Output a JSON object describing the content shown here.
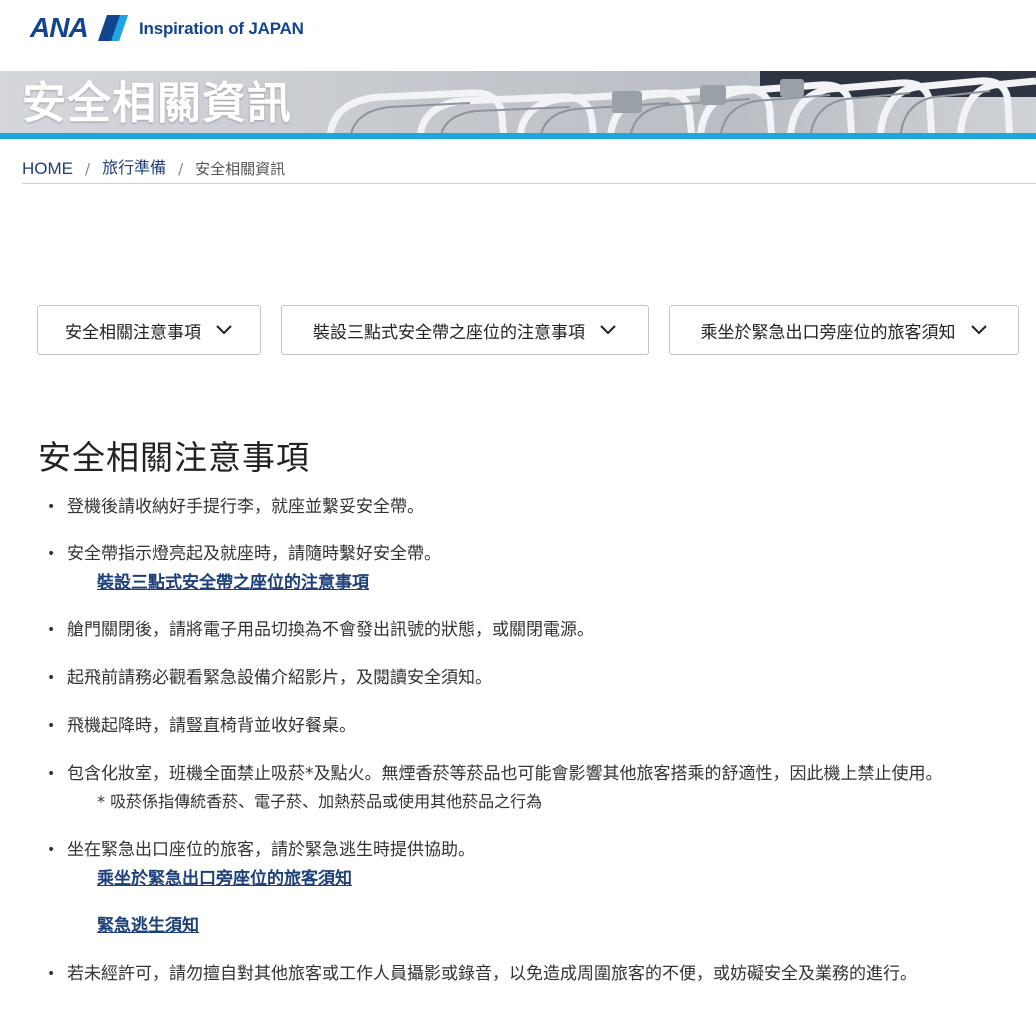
{
  "header": {
    "logo_text": "ANA",
    "tagline": "Inspiration of JAPAN",
    "brand_color": "#13448f",
    "stripe_color": "#1fa6e0"
  },
  "hero": {
    "title": "安全相關資訊"
  },
  "breadcrumb": {
    "home": "HOME",
    "separator": "/",
    "parent": "旅行準備",
    "current": "安全相關資訊"
  },
  "anchors": [
    {
      "label": "安全相關注意事項",
      "icon": "chevron-down-icon"
    },
    {
      "label": "裝設三點式安全帶之座位的注意事項",
      "icon": "chevron-down-icon"
    },
    {
      "label": "乘坐於緊急出口旁座位的旅客須知",
      "icon": "chevron-down-icon"
    }
  ],
  "section": {
    "title": "安全相關注意事項",
    "bullet": "•",
    "items": [
      {
        "text": "登機後請收納好手提行李，就座並繫妥安全帶。"
      },
      {
        "text": "安全帶指示燈亮起及就座時，請隨時繫好安全帶。",
        "link": "裝設三點式安全帶之座位的注意事項"
      },
      {
        "text": "艙門關閉後，請將電子用品切換為不會發出訊號的狀態，或關閉電源。"
      },
      {
        "text": "起飛前請務必觀看緊急設備介紹影片，及閱讀安全須知。"
      },
      {
        "text": "飛機起降時，請豎直椅背並收好餐桌。"
      },
      {
        "text": "包含化妝室，班機全面禁止吸菸*及點火。無煙香菸等菸品也可能會影響其他旅客搭乘的舒適性，因此機上禁止使用。",
        "note": "* 吸菸係指傳統香菸、電子菸、加熱菸品或使用其他菸品之行為"
      },
      {
        "text": "坐在緊急出口座位的旅客，請於緊急逃生時提供協助。",
        "link": "乘坐於緊急出口旁座位的旅客須知",
        "link2": "緊急逃生須知"
      },
      {
        "text": "若未經許可，請勿擅自對其他旅客或工作人員攝影或錄音，以免造成周圍旅客的不便，或妨礙安全及業務的進行。"
      }
    ]
  }
}
